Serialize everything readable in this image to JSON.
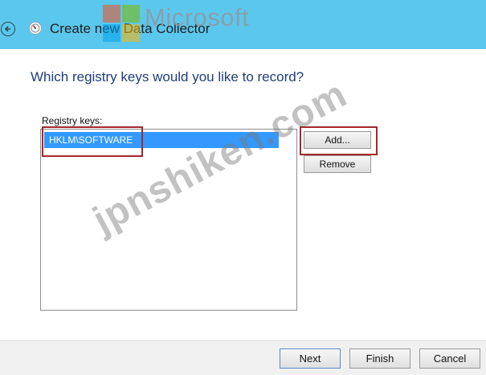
{
  "window": {
    "title": "Create new Data Collector",
    "watermark_brand": "Microsoft",
    "accent_color": "#5cc7ec"
  },
  "icons": {
    "back": "back-arrow-icon",
    "app": "data-collector-icon"
  },
  "main": {
    "heading": "Which registry keys would you like to record?",
    "list_label": "Registry keys:",
    "registry_keys": [
      "HKLM\\SOFTWARE"
    ],
    "selected_index": 0
  },
  "buttons": {
    "add": "Add...",
    "remove": "Remove"
  },
  "footer": {
    "next": "Next",
    "finish": "Finish",
    "cancel": "Cancel"
  },
  "watermark": {
    "text": "jpnshiken.com"
  },
  "colors": {
    "selection": "#3399ff",
    "highlight_box": "#a5272c",
    "heading": "#1f3d7a"
  }
}
